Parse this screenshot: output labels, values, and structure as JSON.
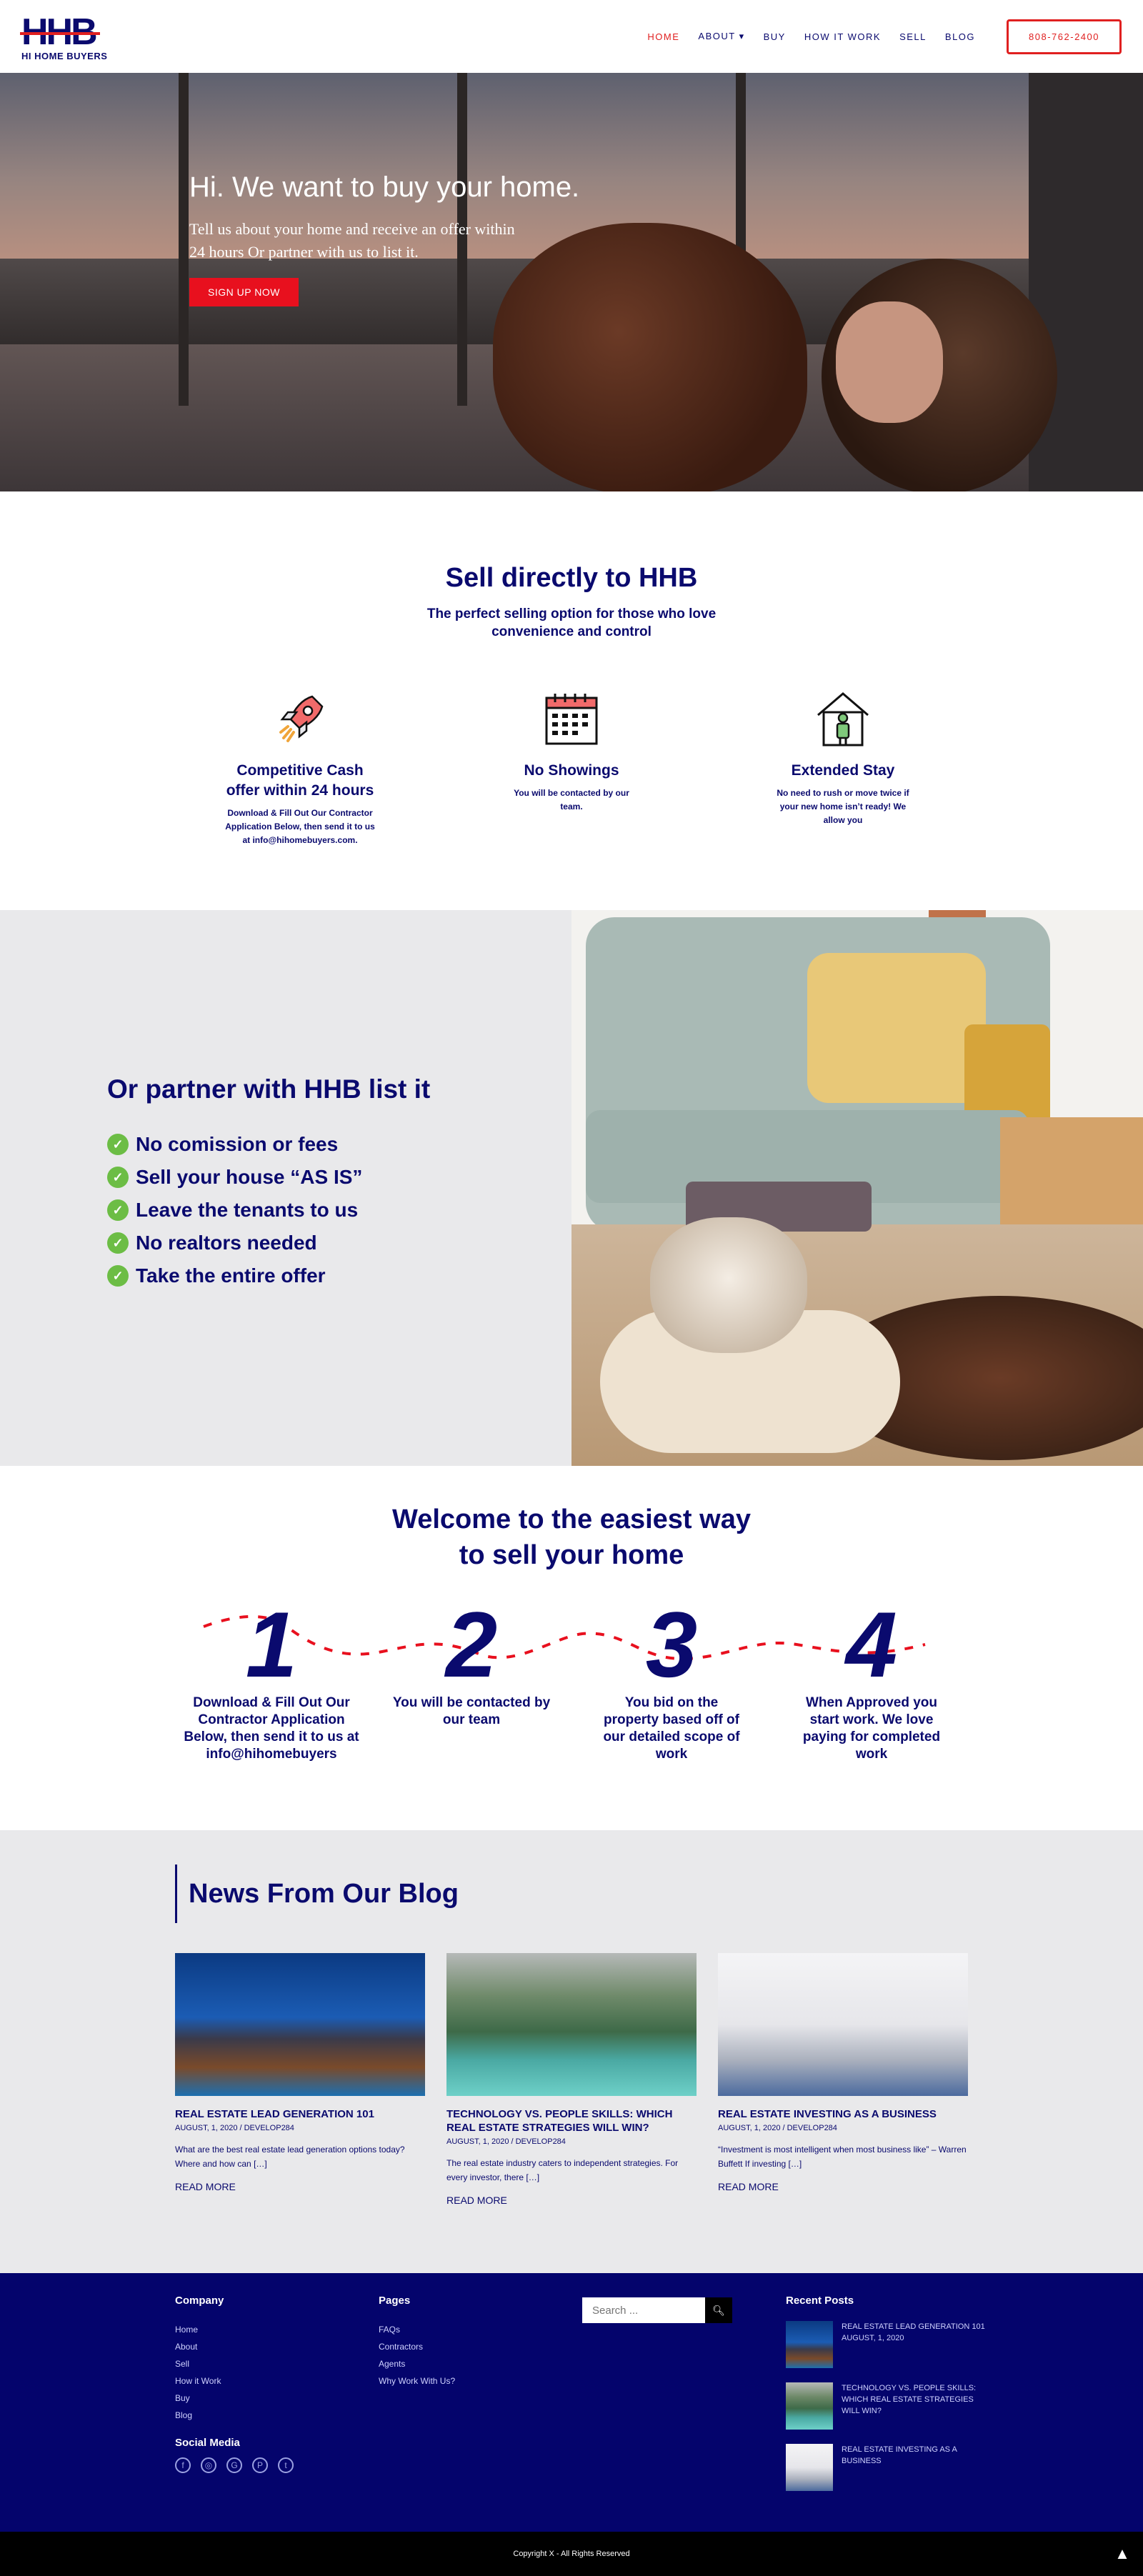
{
  "logo": {
    "mark": "HHB",
    "sub": "HI HOME BUYERS"
  },
  "nav": {
    "items": [
      {
        "label": "HOME"
      },
      {
        "label": "ABOUT ▾"
      },
      {
        "label": "BUY"
      },
      {
        "label": "HOW IT WORK"
      },
      {
        "label": "SELL"
      },
      {
        "label": "BLOG"
      }
    ],
    "phone": "808-762-2400"
  },
  "hero": {
    "title": "Hi. We want to buy your home.",
    "text": "Tell us about your home and receive an offer within 24 hours Or partner with us to list it.",
    "button": "SIGN UP NOW"
  },
  "sell": {
    "title": "Sell directly to HHB",
    "subtitle": "The perfect selling option for those who love convenience and control",
    "features": [
      {
        "icon": "rocket-icon",
        "title": "Competitive Cash offer within 24 hours",
        "text": "Download & Fill Out Our Contractor Application Below, then send it to us at info@hihomebuyers.com."
      },
      {
        "icon": "calendar-icon",
        "title": "No Showings",
        "text": "You will be contacted by our team."
      },
      {
        "icon": "house-person-icon",
        "title": "Extended Stay",
        "text": "No need to rush or move twice if your new home isn’t ready! We allow you"
      }
    ]
  },
  "partner": {
    "title": "Or partner with HHB list it",
    "items": [
      "No comission or fees",
      "Sell your house “AS IS”",
      "Leave the tenants to us",
      "No realtors needed",
      "Take the entire offer"
    ]
  },
  "steps": {
    "title_line1": "Welcome to the easiest way",
    "title_line2": "to sell your home",
    "items": [
      {
        "num": "1",
        "text": "Download & Fill Out Our Contractor Application Below, then send it to us at info@hihomebuyers"
      },
      {
        "num": "2",
        "text": "You will be contacted by our team"
      },
      {
        "num": "3",
        "text": "You bid on the property based off of our detailed scope of work"
      },
      {
        "num": "4",
        "text": "When Approved you start work. We love paying for completed work"
      }
    ]
  },
  "blog": {
    "heading": "News From Our Blog",
    "posts": [
      {
        "title": "REAL ESTATE LEAD GENERATION 101",
        "meta": "AUGUST, 1, 2020 / DEVELOP284",
        "excerpt": "What are the best real estate lead generation options today? Where and how can […]",
        "more": "READ MORE"
      },
      {
        "title": "TECHNOLOGY VS. PEOPLE SKILLS: WHICH REAL ESTATE STRATEGIES WILL WIN?",
        "meta": "AUGUST, 1, 2020 / DEVELOP284",
        "excerpt": "The real estate industry caters to independent strategies. For every investor, there […]",
        "more": "READ MORE"
      },
      {
        "title": "REAL ESTATE INVESTING AS A BUSINESS",
        "meta": "AUGUST, 1, 2020 / DEVELOP284",
        "excerpt": "“Investment is most intelligent when most business like” – Warren Buffett If investing […]",
        "more": "READ MORE"
      }
    ]
  },
  "footer": {
    "company_heading": "Company",
    "company_links": [
      "Home",
      "About",
      "Sell",
      "How it Work",
      "Buy",
      "Blog"
    ],
    "social_heading": "Social Media",
    "pages_heading": "Pages",
    "pages_links": [
      "FAQs",
      "Contractors",
      "Agents",
      "Why Work With Us?"
    ],
    "search_placeholder": "Search ...",
    "recent_heading": "Recent Posts",
    "recent": [
      {
        "title": "REAL ESTATE LEAD GENERATION 101",
        "date": "AUGUST, 1, 2020"
      },
      {
        "title": "TECHNOLOGY VS. PEOPLE SKILLS: WHICH REAL ESTATE STRATEGIES WILL WIN?"
      },
      {
        "title": "REAL ESTATE INVESTING AS A BUSINESS"
      }
    ],
    "copyright": "Copyright X - All Rights Reserved"
  },
  "colors": {
    "navy": "#0a0a6e",
    "red": "#e02020",
    "green": "#6cbd45",
    "footer": "#04046c"
  }
}
